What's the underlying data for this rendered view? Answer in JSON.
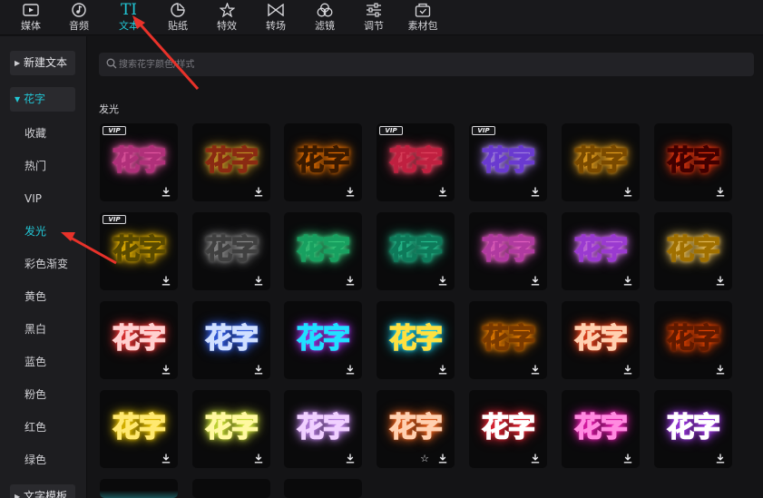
{
  "toolbar": [
    {
      "label": "媒体",
      "icon": "media-icon"
    },
    {
      "label": "音频",
      "icon": "audio-icon"
    },
    {
      "label": "文本",
      "icon": "text-icon",
      "active": true
    },
    {
      "label": "贴纸",
      "icon": "sticker-icon"
    },
    {
      "label": "特效",
      "icon": "effects-icon"
    },
    {
      "label": "转场",
      "icon": "transition-icon"
    },
    {
      "label": "滤镜",
      "icon": "filter-icon"
    },
    {
      "label": "调节",
      "icon": "adjust-icon"
    },
    {
      "label": "素材包",
      "icon": "material-pack-icon"
    }
  ],
  "sidebar": {
    "new_text": "新建文本",
    "fancy_text": "花字",
    "items": [
      "收藏",
      "热门",
      "VIP",
      "发光",
      "彩色渐变",
      "黄色",
      "黑白",
      "蓝色",
      "粉色",
      "红色",
      "绿色"
    ],
    "active_item": "发光",
    "text_template": "文字模板"
  },
  "search": {
    "placeholder": "搜索花字颜色/样式"
  },
  "section_title": "发光",
  "tile_text": "花字",
  "vip_badge": "VIP",
  "tiles": [
    {
      "fill": "#f6c8e6",
      "glow": "#ff5fb4",
      "stroke": "#b0307a",
      "vip": true
    },
    {
      "fill": "#ffe08a",
      "glow": "#d8a12a",
      "stroke": "#8a2a12"
    },
    {
      "fill": "#ff9a1a",
      "glow": "#ff7b00",
      "stroke": "#3a1a00"
    },
    {
      "fill": "#ffc2c2",
      "glow": "#ff4a6a",
      "stroke": "#c02040",
      "vip": true
    },
    {
      "fill": "#f3d2ff",
      "glow": "#b48cff",
      "stroke": "#6a3ad0",
      "vip": true
    },
    {
      "fill": "#ffe8b0",
      "glow": "#ffb020",
      "stroke": "#7a4a00"
    },
    {
      "fill": "#d02010",
      "glow": "#ff3a10",
      "stroke": "#400000"
    },
    {
      "fill": "#fff176",
      "glow": "#ffc400",
      "stroke": "#5a4a00",
      "vip": true
    },
    {
      "fill": "#b8b8b8",
      "glow": "#9a9a9a",
      "stroke": "#404040"
    },
    {
      "fill": "#ffffff",
      "glow": "#3ce08a",
      "stroke": "#18a060"
    },
    {
      "fill": "#b8ffe8",
      "glow": "#2ad6a0",
      "stroke": "#0e7a5a"
    },
    {
      "fill": "#ffd4ff",
      "glow": "#ff6ad8",
      "stroke": "#b03aa0"
    },
    {
      "fill": "#ffffff",
      "glow": "#e07aff",
      "stroke": "#9a3ad0"
    },
    {
      "fill": "#ffffff",
      "glow": "#ffd060",
      "stroke": "#a07000"
    },
    {
      "fill": "#ff7a7a",
      "glow": "#ff3a3a",
      "stroke": "#ffd0d0"
    },
    {
      "fill": "#7aa8ff",
      "glow": "#3a6aff",
      "stroke": "#d0e0ff"
    },
    {
      "fill": "#ffffff",
      "glow": "#b03aff",
      "stroke": "#20e0ff"
    },
    {
      "fill": "#ff6ad8",
      "glow": "#20e0ff",
      "stroke": "#ffe040"
    },
    {
      "fill": "#ffb020",
      "glow": "#ff8a00",
      "stroke": "#7a3a00"
    },
    {
      "fill": "#ff8a5a",
      "glow": "#ff4a20",
      "stroke": "#ffd0b0"
    },
    {
      "fill": "#ff7a20",
      "glow": "#ff4a00",
      "stroke": "#601a00"
    },
    {
      "fill": "#2a2000",
      "glow": "#ffd400",
      "stroke": "#ffe870"
    },
    {
      "fill": "#1a1a00",
      "glow": "#e8ff40",
      "stroke": "#fff8a0"
    },
    {
      "fill": "#2a1a30",
      "glow": "#d090ff",
      "stroke": "#f0d0ff"
    },
    {
      "fill": "#2a80ff",
      "glow": "#ff6a20",
      "stroke": "#ffd0b0",
      "star": true
    },
    {
      "fill": "#c01020",
      "glow": "#ff2a3a",
      "stroke": "#ffffff"
    },
    {
      "fill": "#ffffff",
      "glow": "#ff20c0",
      "stroke": "#ff8ae0"
    },
    {
      "fill": "#101010",
      "glow": "#b040ff",
      "stroke": "#ffffff"
    },
    {
      "fill": "#0a0a0b",
      "glow": "#2ad6e0",
      "stroke": "#0a0a0b",
      "partial": true
    },
    {
      "fill": "#0a0a0b",
      "glow": "#0a0a0b",
      "stroke": "#0a0a0b",
      "partial": true
    },
    {
      "fill": "#0a0a0b",
      "glow": "#0a0a0b",
      "stroke": "#0a0a0b",
      "partial": true
    }
  ],
  "colors": {
    "accent": "#22c7d6",
    "annotation": "#e8322a"
  }
}
